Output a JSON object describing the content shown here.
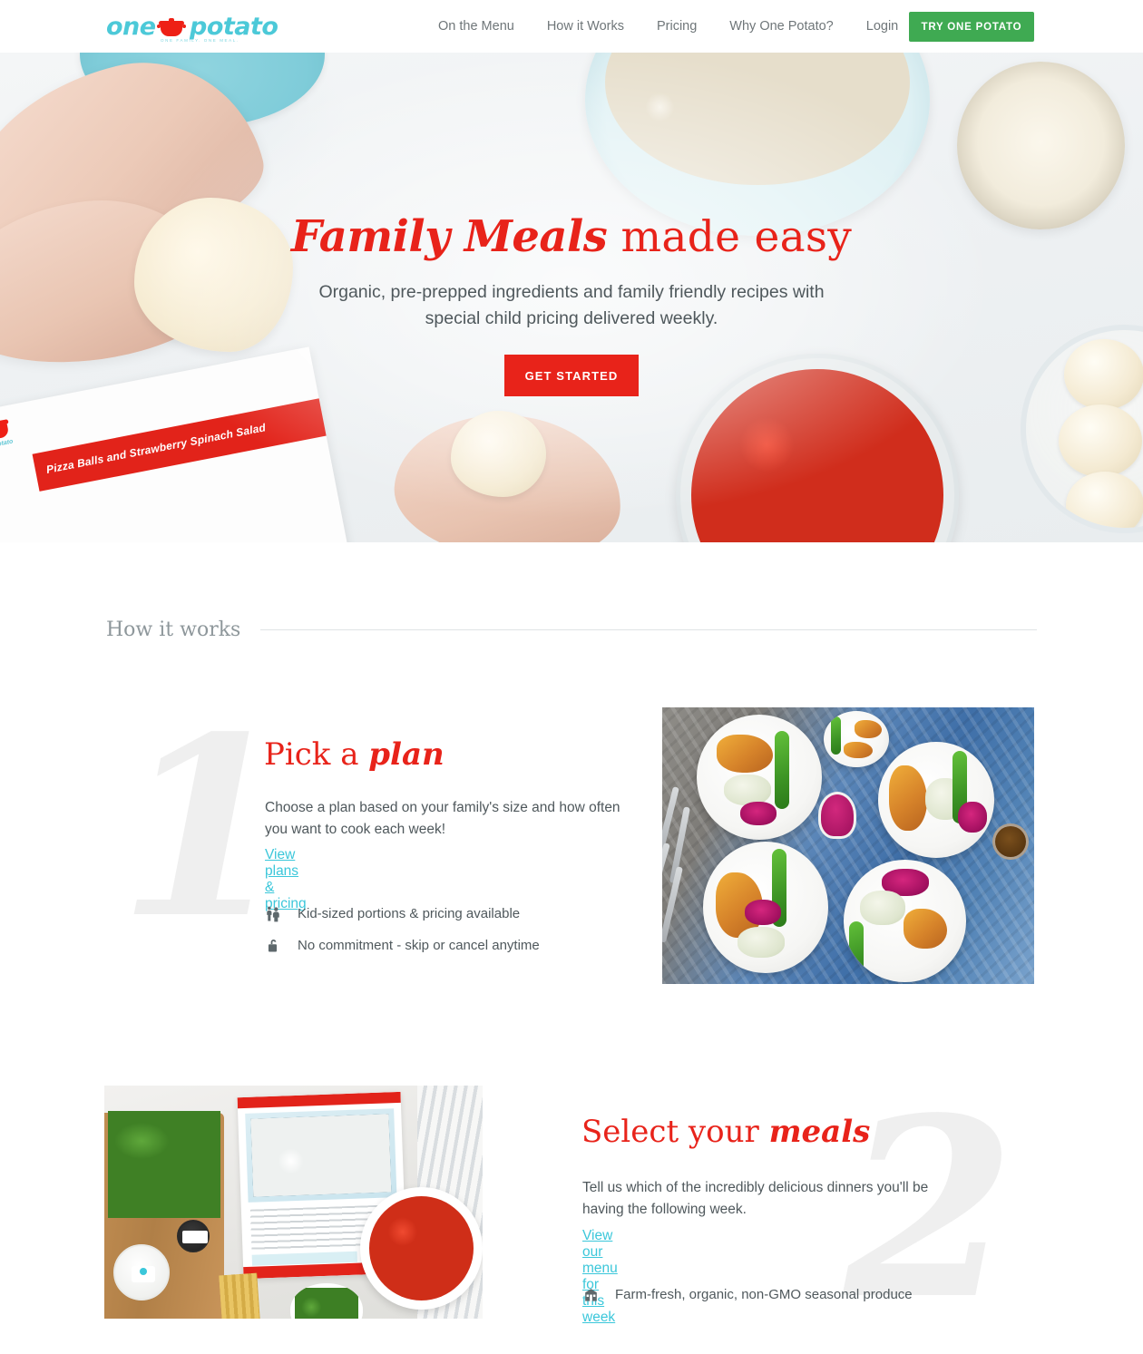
{
  "header": {
    "logo": {
      "word_one": "one",
      "word_potato": "potato",
      "tagline": "ONE FAMILY. ONE MEAL.",
      "pot_icon": "red-pot-icon"
    },
    "nav_items": [
      {
        "label": "On the Menu"
      },
      {
        "label": "How it Works"
      },
      {
        "label": "Pricing"
      },
      {
        "label": "Why One Potato?"
      },
      {
        "label": "Login"
      }
    ],
    "cta_label": "TRY ONE POTATO",
    "cta_color": "#3faa52"
  },
  "hero": {
    "title_script": "Family Meals",
    "title_plain": " made easy",
    "subtitle": "Organic, pre-prepped ingredients and family friendly recipes with special child pricing delivered weekly.",
    "button_label": "GET STARTED",
    "button_color": "#e8231a",
    "recipe_card_text": "Pizza Balls and Strawberry Spinach Salad",
    "recipe_card_logo": "one potato"
  },
  "how_it_works": {
    "section_title": "How it works",
    "steps": [
      {
        "number": "1",
        "title_plain": "Pick a ",
        "title_script": "plan",
        "body": "Choose a plan based on your family's size and how often you want to cook each week!",
        "link_label": "View plans & pricing",
        "features": [
          {
            "icon": "kids-family-icon",
            "text": "Kid-sized portions & pricing available"
          },
          {
            "icon": "unlocked-padlock-icon",
            "text": "No commitment - skip or cancel anytime"
          }
        ]
      },
      {
        "number": "2",
        "title_plain": "Select your ",
        "title_script": "meals",
        "body": "Tell us which of the incredibly delicious dinners you'll be having the following week.",
        "link_label": "View our menu for this week",
        "features": [
          {
            "icon": "barn-farm-icon",
            "text": "Farm-fresh, organic, non-GMO seasonal produce"
          }
        ]
      }
    ]
  },
  "colors": {
    "brand_red": "#e8231a",
    "brand_teal": "#3bc7da",
    "brand_green": "#3faa52",
    "body_text": "#4f585c",
    "muted_text": "#8e979b",
    "ghost_number": "#efefef"
  }
}
